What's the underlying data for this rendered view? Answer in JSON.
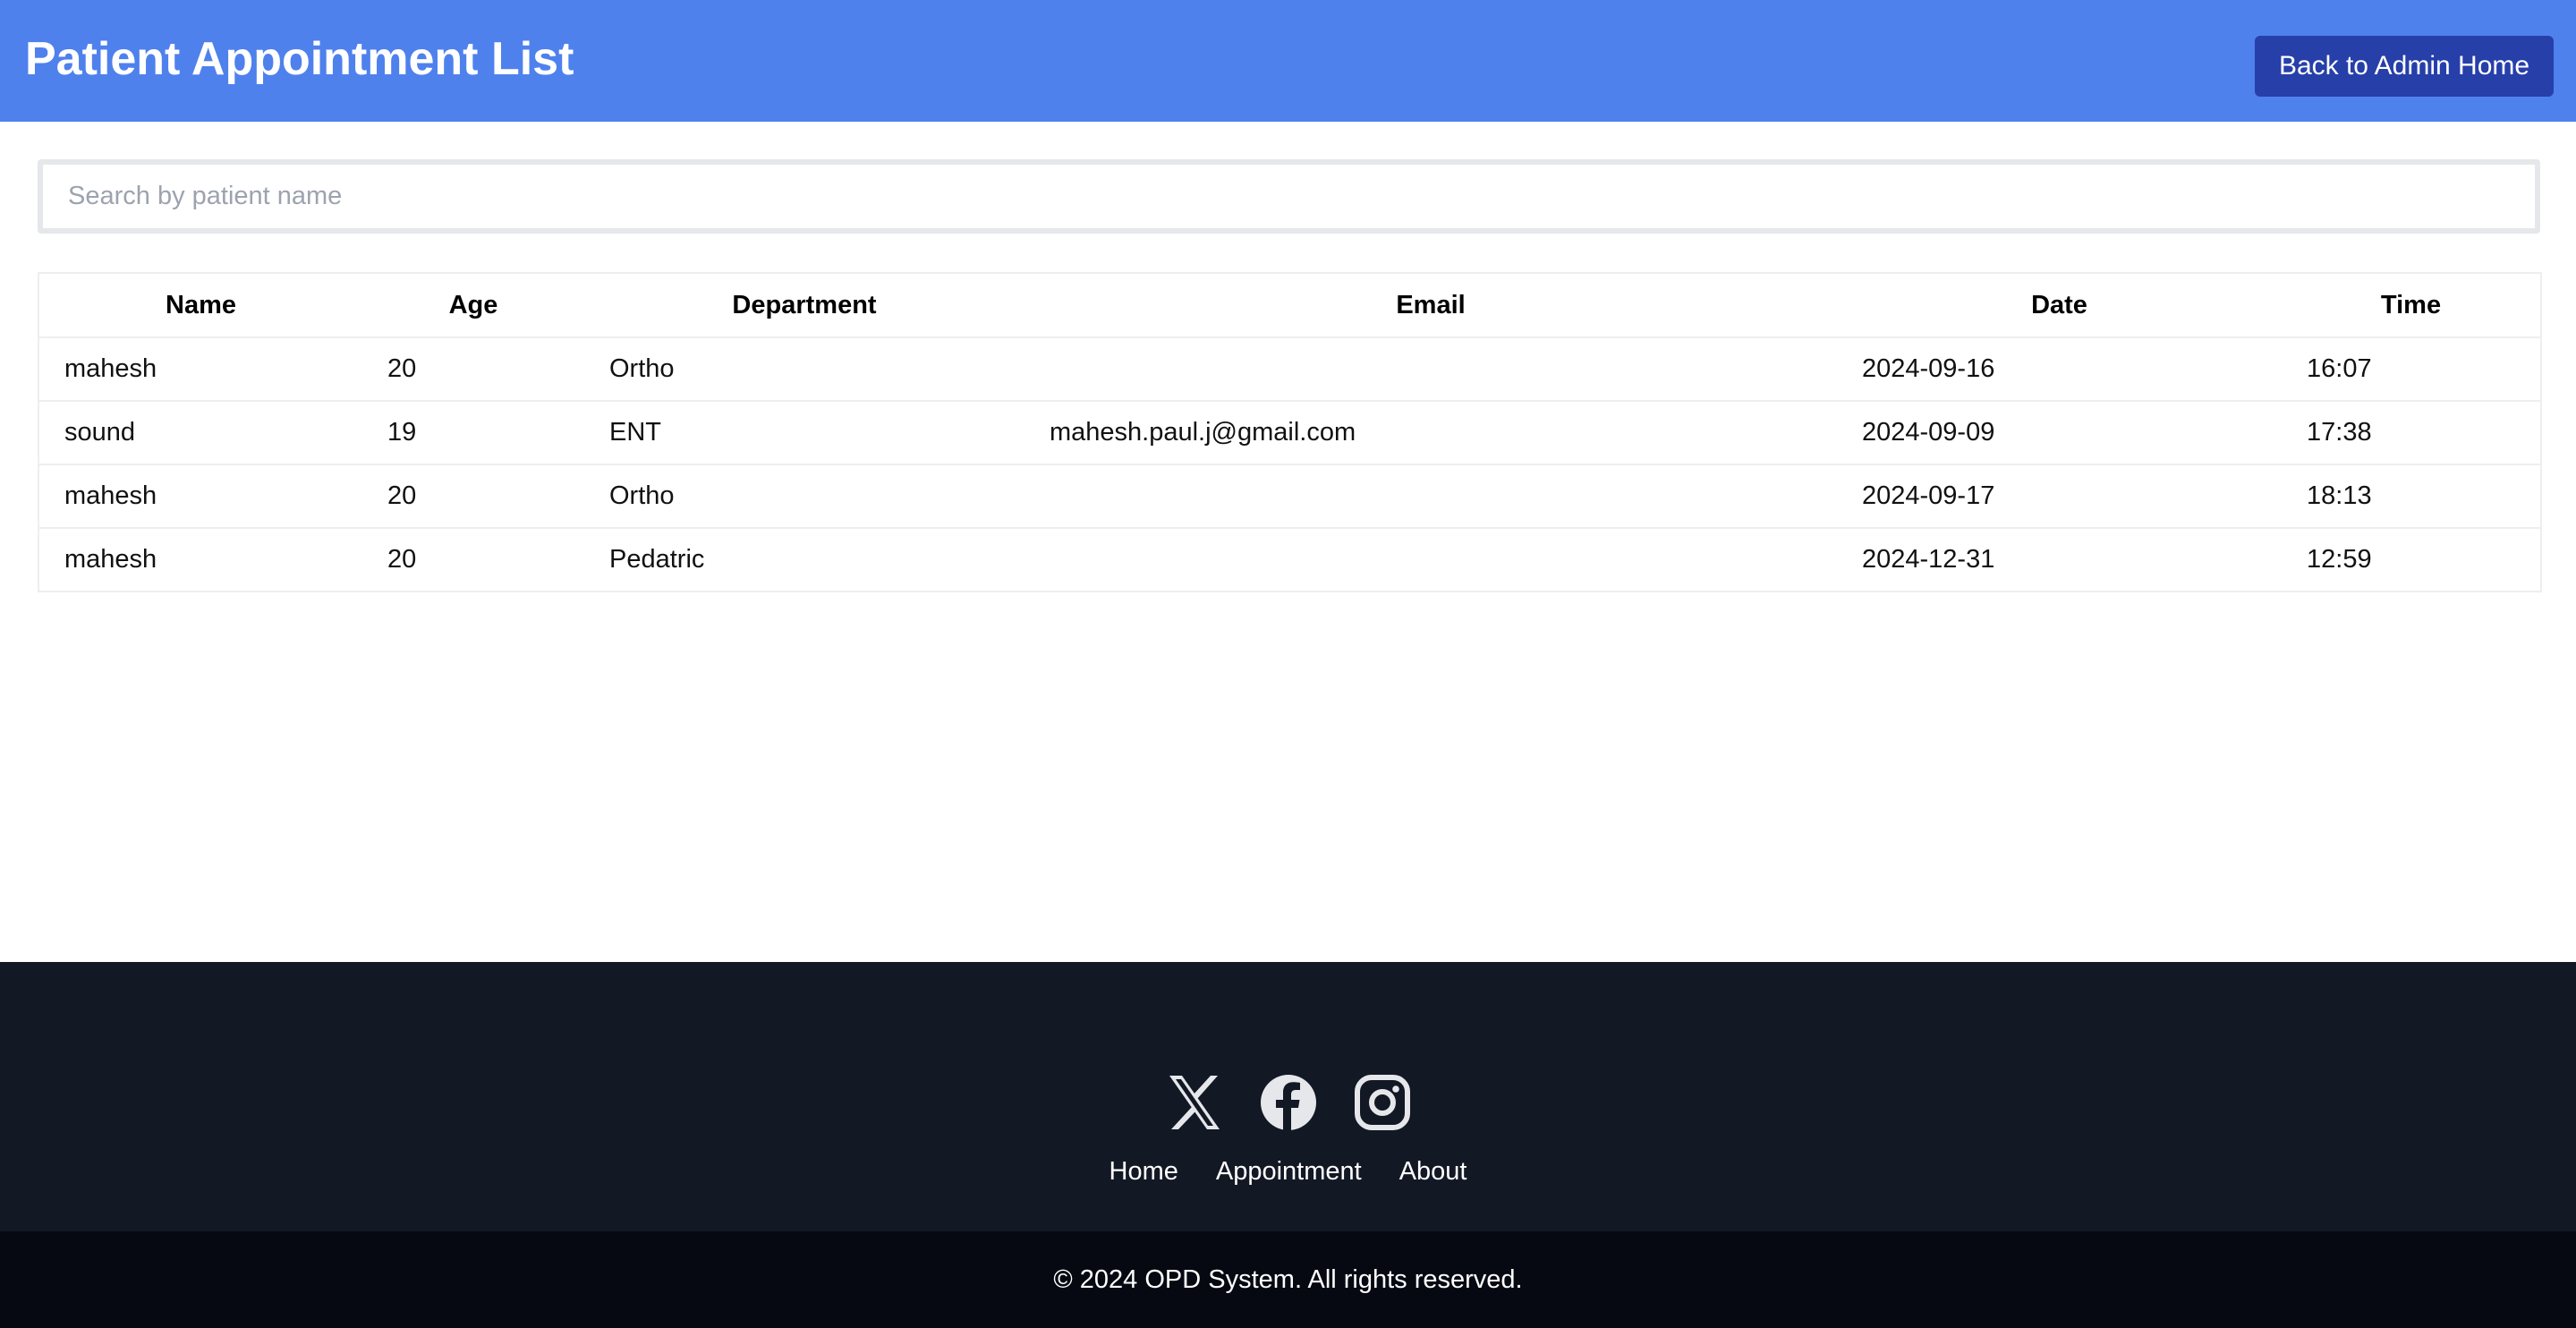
{
  "header": {
    "title": "Patient Appointment List",
    "back_button_label": "Back to Admin Home"
  },
  "search": {
    "placeholder": "Search by patient name",
    "value": ""
  },
  "table": {
    "columns": [
      "Name",
      "Age",
      "Department",
      "Email",
      "Date",
      "Time"
    ],
    "rows": [
      {
        "name": "mahesh",
        "age": "20",
        "department": "Ortho",
        "email": "",
        "date": "2024-09-16",
        "time": "16:07"
      },
      {
        "name": "sound",
        "age": "19",
        "department": "ENT",
        "email": "mahesh.paul.j@gmail.com",
        "date": "2024-09-09",
        "time": "17:38"
      },
      {
        "name": "mahesh",
        "age": "20",
        "department": "Ortho",
        "email": "",
        "date": "2024-09-17",
        "time": "18:13"
      },
      {
        "name": "mahesh",
        "age": "20",
        "department": "Pedatric",
        "email": "",
        "date": "2024-12-31",
        "time": "12:59"
      }
    ]
  },
  "footer": {
    "social_icons": [
      "x-icon",
      "facebook-icon",
      "instagram-icon"
    ],
    "links": [
      "Home",
      "Appointment",
      "About"
    ],
    "copyright": "© 2024 OPD System. All rights reserved."
  },
  "colors": {
    "header_bg": "#4f81ed",
    "button_bg": "#263fa9",
    "footer_bg": "#131825",
    "bottom_bar_bg": "#060912",
    "icon_color": "#e5e7eb"
  }
}
